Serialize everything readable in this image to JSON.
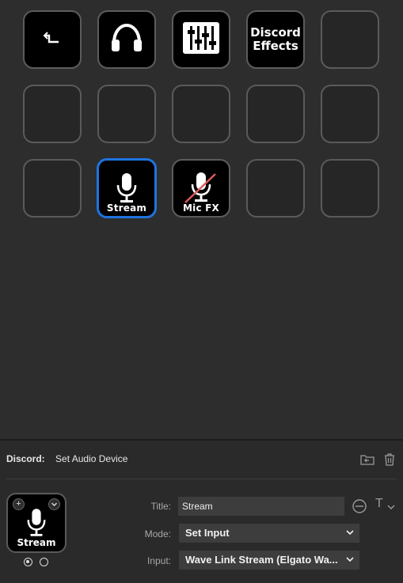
{
  "keys": {
    "r1": [
      {
        "type": "icon",
        "icon": "back-arrow-icon"
      },
      {
        "type": "icon",
        "icon": "headphones-icon"
      },
      {
        "type": "icon",
        "icon": "mixer-sliders-icon"
      },
      {
        "type": "text",
        "text_line1": "Discord",
        "text_line2": "Effects"
      },
      {
        "type": "empty"
      }
    ],
    "stream_label": "Stream",
    "micfx_label": "Mic FX"
  },
  "inspector": {
    "plugin_name": "Discord:",
    "action_name": "Set Audio Device",
    "preview_label": "Stream",
    "title_label": "Title:",
    "title_value": "Stream",
    "mode_label": "Mode:",
    "mode_value": "Set Input",
    "input_label": "Input:",
    "input_value": "Wave Link Stream (Elgato Wa..."
  },
  "colors": {
    "background": "#2d2d2d",
    "selected_border": "#1f74e0",
    "mute_slash": "#e05a5a"
  }
}
